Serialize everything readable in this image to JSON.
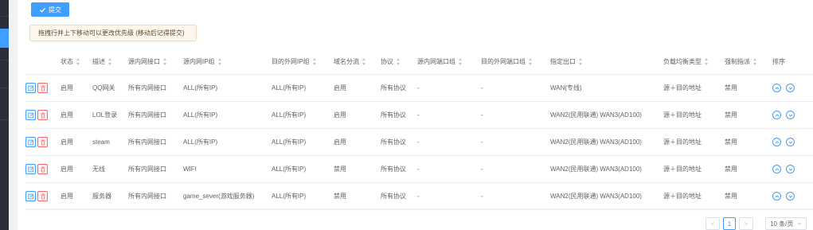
{
  "toolbar": {
    "submit_label": "提交"
  },
  "tip": {
    "text": "拖拽行并上下移动可以更改优先级 (移动后记得提交)"
  },
  "table": {
    "columns": [
      "状态",
      "描述",
      "源内网接口",
      "源内网IP组",
      "目的外网IP组",
      "域名分流",
      "协议",
      "源内网端口组",
      "目的外网端口组",
      "指定出口",
      "负载均衡类型",
      "强制指派",
      "排序"
    ],
    "rows": [
      {
        "status": "启用",
        "desc": "QQ网关",
        "src_iface": "所有内网接口",
        "src_ip": "ALL(所有IP)",
        "dst_ip": "ALL(所有IP)",
        "domain": "启用",
        "protocol": "所有协议",
        "src_port": "-",
        "dst_port": "-",
        "egress": "WAN(专线)",
        "lb": "源＋目的地址",
        "force": "禁用"
      },
      {
        "status": "启用",
        "desc": "LOL登录",
        "src_iface": "所有内网接口",
        "src_ip": "ALL(所有IP)",
        "dst_ip": "ALL(所有IP)",
        "domain": "启用",
        "protocol": "所有协议",
        "src_port": "-",
        "dst_port": "-",
        "egress": "WAN2(民用联通) WAN3(AD100)",
        "lb": "源＋目的地址",
        "force": "禁用"
      },
      {
        "status": "启用",
        "desc": "steam",
        "src_iface": "所有内网接口",
        "src_ip": "ALL(所有IP)",
        "dst_ip": "ALL(所有IP)",
        "domain": "启用",
        "protocol": "所有协议",
        "src_port": "-",
        "dst_port": "-",
        "egress": "WAN2(民用联通) WAN3(AD100)",
        "lb": "源＋目的地址",
        "force": "禁用"
      },
      {
        "status": "启用",
        "desc": "无线",
        "src_iface": "所有内网接口",
        "src_ip": "WIFI",
        "dst_ip": "ALL(所有IP)",
        "domain": "禁用",
        "protocol": "所有协议",
        "src_port": "-",
        "dst_port": "-",
        "egress": "WAN2(民用联通) WAN3(AD100)",
        "lb": "源＋目的地址",
        "force": "禁用"
      },
      {
        "status": "启用",
        "desc": "服务器",
        "src_iface": "所有内网接口",
        "src_ip": "game_sever(游戏服务器)",
        "dst_ip": "ALL(所有IP)",
        "domain": "禁用",
        "protocol": "所有协议",
        "src_port": "-",
        "dst_port": "-",
        "egress": "WAN2(民用联通) WAN3(AD100)",
        "lb": "源＋目的地址",
        "force": "禁用"
      }
    ]
  },
  "pagination": {
    "prev": "<",
    "current_page": "1",
    "next": ">",
    "page_size": "10 条/页"
  },
  "colors": {
    "primary": "#409eff",
    "danger": "#f56c6c",
    "warning_bg": "#fdf6ec",
    "sidebar": "#2b2f3a"
  },
  "icons": {
    "submit": "check-icon",
    "edit": "edit-icon",
    "delete": "trash-icon",
    "up": "arrow-up-circle-icon",
    "down": "arrow-down-circle-icon"
  }
}
